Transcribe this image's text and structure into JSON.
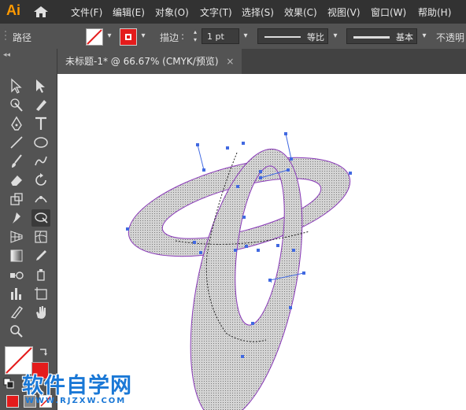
{
  "app": {
    "logo": "Ai"
  },
  "menu": [
    "文件(F)",
    "编辑(E)",
    "对象(O)",
    "文字(T)",
    "选择(S)",
    "效果(C)",
    "视图(V)",
    "窗口(W)",
    "帮助(H)"
  ],
  "control_bar": {
    "selection_label": "路径",
    "stroke_label": "描边",
    "stroke_weight": "1 pt",
    "variable_width_profile": "等比",
    "brush_definition": "基本",
    "opacity_label": "不透明"
  },
  "document": {
    "tab_title": "未标题-1* @ 66.67% (CMYK/预览)",
    "tab_close": "×"
  },
  "tools": [
    "selection-tool",
    "direct-selection-tool",
    "magic-wand-tool",
    "lasso-tool",
    "pen-tool",
    "type-tool",
    "line-tool",
    "ellipse-tool",
    "paintbrush-tool",
    "shaper-tool",
    "eraser-tool",
    "rotate-tool",
    "scale-tool",
    "puppet-warp-tool",
    "pin-tool",
    "shape-builder-tool",
    "perspective-grid-tool",
    "mesh-tool",
    "gradient-tool",
    "eyedropper-tool",
    "blend-tool",
    "symbol-sprayer-tool",
    "column-graph-tool",
    "artboard-tool",
    "slice-tool",
    "hand-tool",
    "zoom-tool"
  ],
  "colors": {
    "fill": "#ffffff",
    "stroke": "#e41b1b",
    "anchor": "#4169e1",
    "path": "#8a3ab9",
    "shape_fill": "#c8c8c8"
  },
  "watermark": {
    "title": "软件自学网",
    "url": "WWW.RJZXW.COM"
  }
}
